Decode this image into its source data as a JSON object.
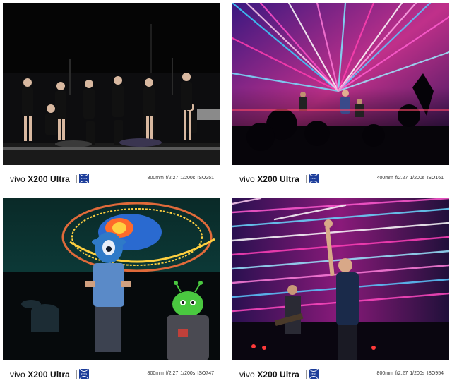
{
  "cards": [
    {
      "brand": "vivo",
      "model": "X200 Ultra",
      "exif": "800mm  f/2.27  1/200s  ISO251",
      "scene": "girl-group-stage"
    },
    {
      "brand": "vivo",
      "model": "X200 Ultra",
      "exif": "400mm  f/2.27  1/200s  ISO161",
      "scene": "concert-lightshow-magenta"
    },
    {
      "brand": "vivo",
      "model": "X200 Ultra",
      "exif": "800mm  f/2.27  1/200s  ISO747",
      "scene": "alien-mask-performers"
    },
    {
      "brand": "vivo",
      "model": "X200 Ultra",
      "exif": "800mm  f/2.27  1/200s  ISO954",
      "scene": "singer-arm-raised-lightshow"
    }
  ],
  "logo": {
    "name": "zeiss-logo",
    "text": "ZEISS",
    "color": "#1c3d9a"
  }
}
